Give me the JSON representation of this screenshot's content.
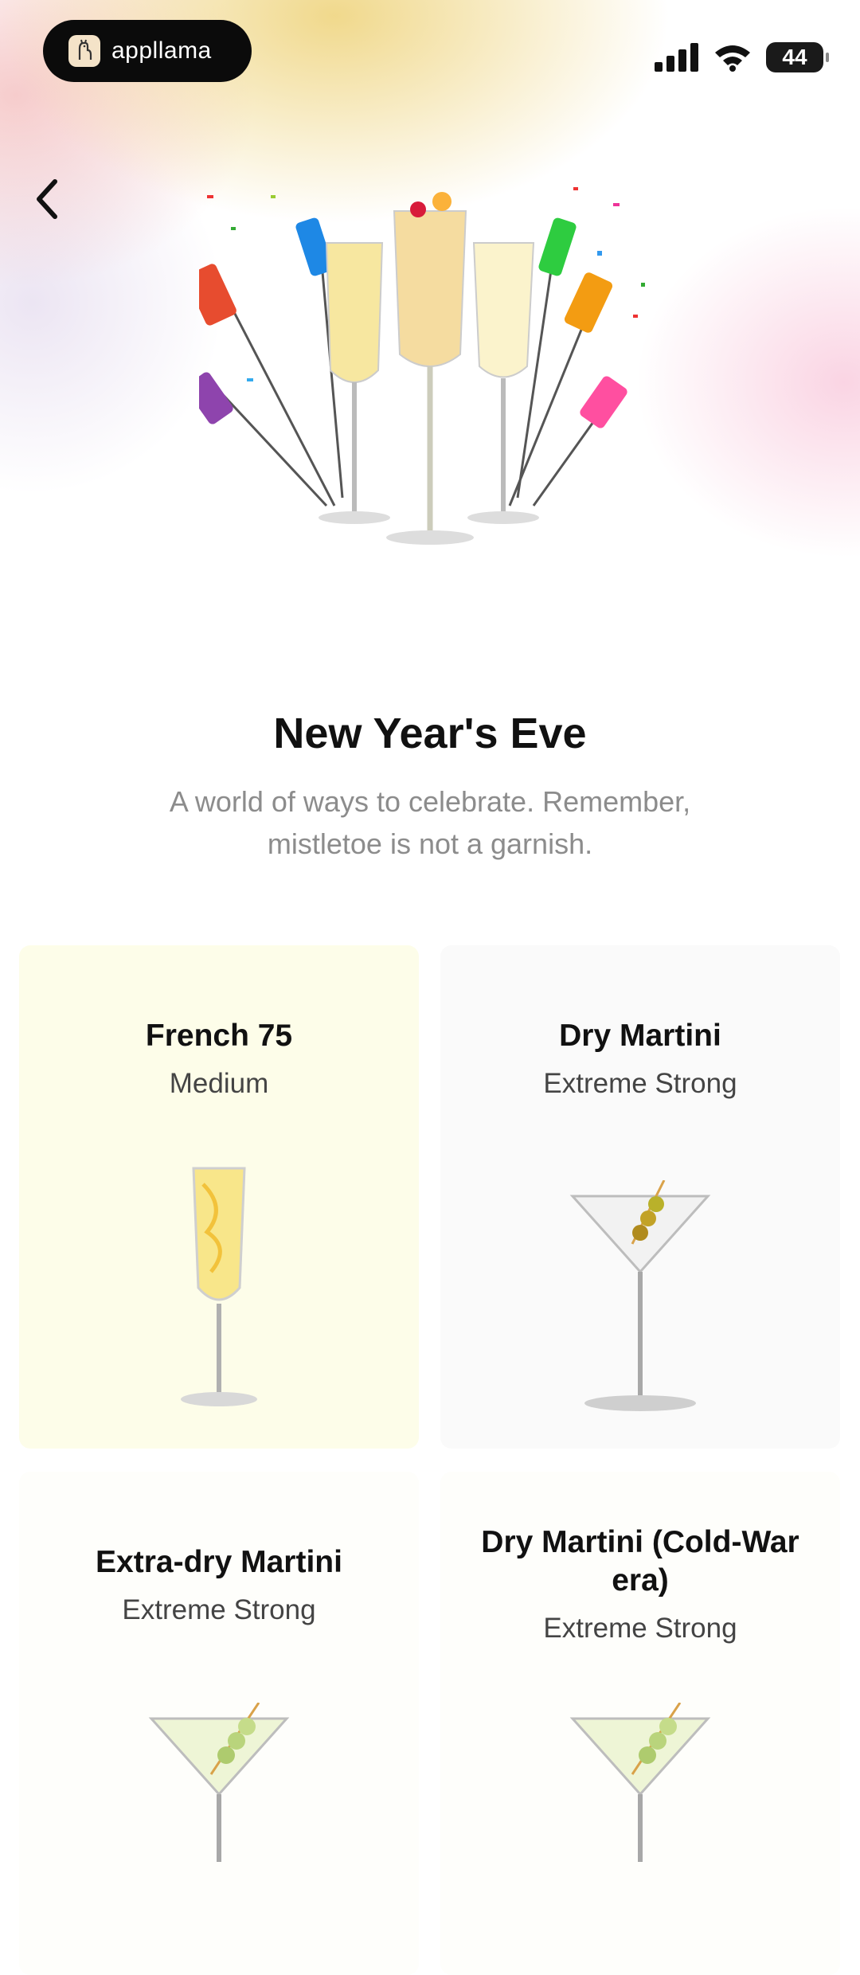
{
  "status_bar": {
    "app_badge": "appllama",
    "battery": "44"
  },
  "page": {
    "title": "New Year's Eve",
    "subtitle": "A world of ways to celebrate. Remember, mistletoe is not a garnish."
  },
  "cocktails": [
    {
      "name": "French 75",
      "strength": "Medium",
      "icon": "flute-glass-icon"
    },
    {
      "name": "Dry Martini",
      "strength": "Extreme Strong",
      "icon": "martini-glass-icon"
    },
    {
      "name": "Extra-dry Martini",
      "strength": "Extreme Strong",
      "icon": "martini-glass-icon"
    },
    {
      "name": "Dry Martini (Cold-War era)",
      "strength": "Extreme Strong",
      "icon": "martini-glass-icon"
    }
  ],
  "colors": {
    "card_highlight": "#fdfde9",
    "card_default": "#fafafa",
    "title": "#111111",
    "subtitle": "#8c8c8c"
  }
}
